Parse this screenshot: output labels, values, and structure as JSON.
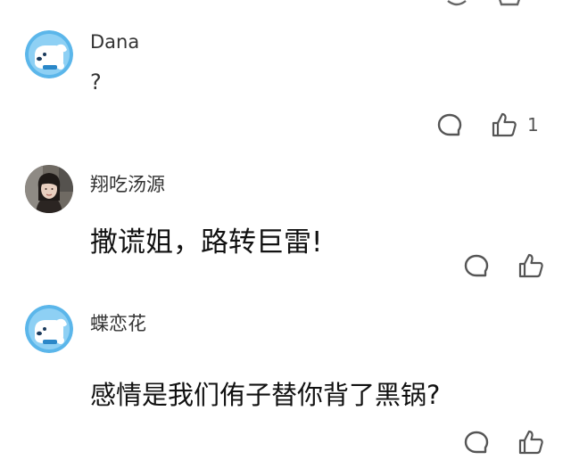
{
  "comments": [
    {
      "username": "Dana",
      "text": "?",
      "avatar": "dog-mascot-avatar",
      "like_count": "1",
      "icons": [
        "comment-bubble-icon",
        "thumbs-up-icon"
      ]
    },
    {
      "username": "翔吃汤源",
      "text": "撒谎姐，路转巨雷!",
      "avatar": "user-photo-avatar",
      "like_count": "",
      "icons": [
        "comment-bubble-icon",
        "thumbs-up-icon"
      ]
    },
    {
      "username": "蝶恋花",
      "text": "感情是我们侑子替你背了黑锅?",
      "avatar": "dog-mascot-avatar",
      "like_count": "",
      "icons": [
        "comment-bubble-icon",
        "thumbs-up-icon"
      ]
    }
  ],
  "colors": {
    "mascot_blue": "#5bb6ea",
    "icon_gray": "#555555",
    "text": "#111111"
  }
}
